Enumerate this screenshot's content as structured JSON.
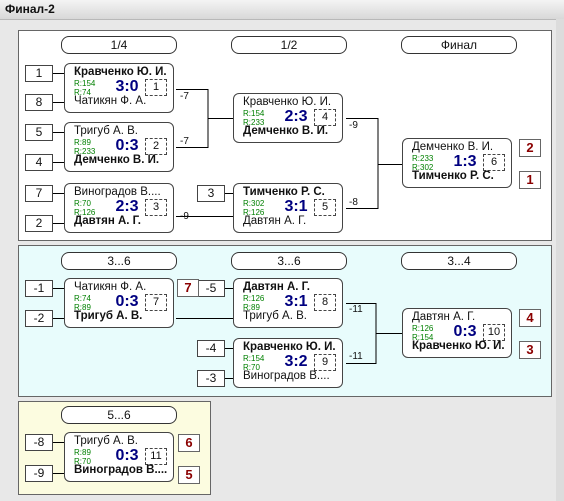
{
  "title": "Финал-2",
  "panel1": {
    "headers": [
      "1/4",
      "1/2",
      "Финал"
    ],
    "seeds": [
      "1",
      "8",
      "5",
      "4",
      "7",
      "2",
      "3"
    ],
    "matches": [
      {
        "p1": "Кравченко Ю. И.",
        "p2": "Чатикян Ф. А.",
        "r1": "R:154",
        "r2": "R:74",
        "score": "3:0",
        "no": "1",
        "win": 1
      },
      {
        "p1": "Тригуб А. В.",
        "p2": "Демченко В. И.",
        "r1": "R:89",
        "r2": "R:233",
        "score": "0:3",
        "no": "2",
        "win": 2
      },
      {
        "p1": "Виноградов В....",
        "p2": "Давтян А. Г.",
        "r1": "R:70",
        "r2": "R:126",
        "score": "2:3",
        "no": "3",
        "win": 2
      },
      {
        "p1": "Кравченко Ю. И.",
        "p2": "Демченко В. И.",
        "r1": "R:154",
        "r2": "R:233",
        "score": "2:3",
        "no": "4",
        "win": 2
      },
      {
        "p1": "Тимченко Р. С.",
        "p2": "Давтян А. Г.",
        "r1": "R:302",
        "r2": "R:126",
        "score": "3:1",
        "no": "5",
        "win": 1
      },
      {
        "p1": "Демченко В. И.",
        "p2": "Тимченко Р. С.",
        "r1": "R:233",
        "r2": "R:302",
        "score": "1:3",
        "no": "6",
        "win": 2
      }
    ],
    "labels": [
      "-7",
      "-7",
      "-9",
      "-9",
      "-8"
    ],
    "places": [
      "2",
      "1"
    ]
  },
  "panel2": {
    "headers": [
      "3...6",
      "3...6",
      "3...4"
    ],
    "seeds": [
      "-1",
      "-2",
      "-5",
      "-4",
      "-3"
    ],
    "matches": [
      {
        "p1": "Чатикян Ф. А.",
        "p2": "Тригуб А. В.",
        "r1": "R:74",
        "r2": "R:89",
        "score": "0:3",
        "no": "7",
        "win": 2
      },
      {
        "p1": "Давтян А. Г.",
        "p2": "Тригуб А. В.",
        "r1": "R:126",
        "r2": "R:89",
        "score": "3:1",
        "no": "8",
        "win": 1
      },
      {
        "p1": "Кравченко Ю. И.",
        "p2": "Виноградов В....",
        "r1": "R:154",
        "r2": "R:70",
        "score": "3:2",
        "no": "9",
        "win": 1
      },
      {
        "p1": "Давтян А. Г.",
        "p2": "Кравченко Ю. И.",
        "r1": "R:126",
        "r2": "R:154",
        "score": "0:3",
        "no": "10",
        "win": 2
      }
    ],
    "labels": [
      "-11",
      "-11"
    ],
    "places": [
      "7",
      "4",
      "3"
    ]
  },
  "panel3": {
    "headers": [
      "5...6"
    ],
    "seeds": [
      "-8",
      "-9"
    ],
    "matches": [
      {
        "p1": "Тригуб А. В.",
        "p2": "Виноградов В....",
        "r1": "R:89",
        "r2": "R:70",
        "score": "0:3",
        "no": "11",
        "win": 2
      }
    ],
    "places": [
      "6",
      "5"
    ]
  },
  "colors": {
    "panel1": "#ffffff",
    "panel2": "#e8fcfc",
    "panel3": "#fcfce0",
    "score": "#000080",
    "rating": "#008000",
    "place": "#8b0000"
  }
}
